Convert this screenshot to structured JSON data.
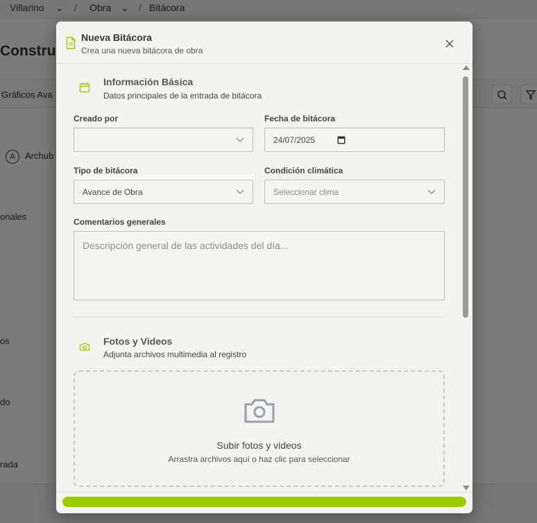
{
  "colors": {
    "accent": "#9ccc00",
    "overlay": "rgba(0,0,0,0.5)"
  },
  "background": {
    "breadcrumb": [
      "Villarino",
      "Obra",
      "Bitácora"
    ],
    "breadcrumb_sep": "/",
    "title_fragment": "Construcc",
    "toolbar_fragment": "Gráficos Ava",
    "archive_initial": "A",
    "archive_fragment": "Archub",
    "side_fragments": [
      "onales",
      "os",
      "do",
      "rada"
    ]
  },
  "modal": {
    "title": "Nueva Bitácora",
    "subtitle": "Crea una nueva bitácora de obra",
    "close_icon": "close-icon",
    "basic": {
      "icon": "calendar-icon",
      "title": "Información Básica",
      "subtitle": "Datos principales de la entrada de bitácora",
      "created_by_label": "Creado por",
      "created_by_value": "",
      "date_label": "Fecha de bitácora",
      "date_value": "24/07/2025",
      "type_label": "Tipo de bitácora",
      "type_value": "Avance de Obra",
      "weather_label": "Condición climática",
      "weather_placeholder": "Seleccionar clima",
      "comments_label": "Comentarios generales",
      "comments_placeholder": "Descripción general de las actividades del día..."
    },
    "media": {
      "icon": "camera-icon",
      "title": "Fotos y Videos",
      "subtitle": "Adjunta archivos multimedia al registro",
      "upload_title": "Subir fotos y videos",
      "upload_subtitle": "Arrastra archivos aquí o haz clic para seleccionar"
    },
    "progress": 1.0
  }
}
